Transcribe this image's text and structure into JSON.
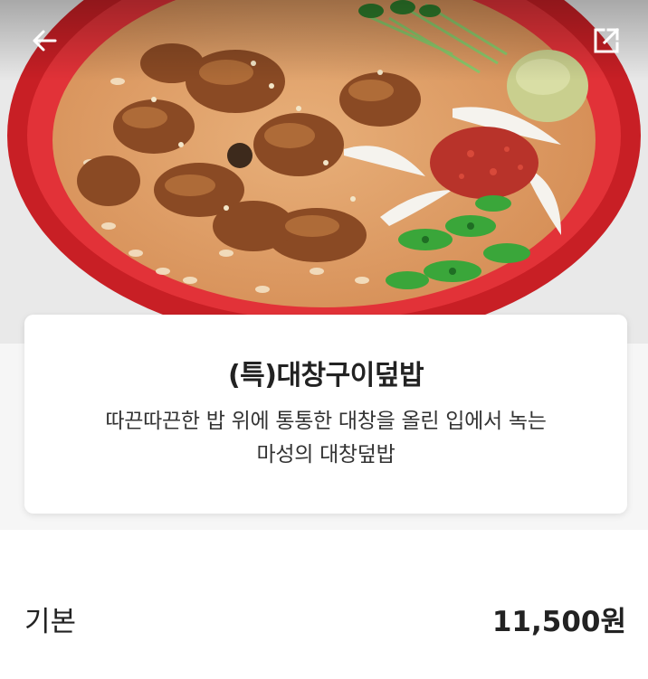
{
  "header": {
    "back_icon": "arrow-left-icon",
    "share_icon": "share-external-icon"
  },
  "hero": {
    "image": "food-photo-daechang-rice-bowl"
  },
  "menu": {
    "title": "(특)대창구이덮밥",
    "description_line1": "따끈따끈한 밥 위에 통통한 대창을 올린 입에서 녹는",
    "description_line2": "마성의 대창덮밥"
  },
  "price": {
    "label": "기본",
    "value": "11,500원"
  },
  "colors": {
    "bowl_red": "#d7262b",
    "text": "#222222"
  }
}
